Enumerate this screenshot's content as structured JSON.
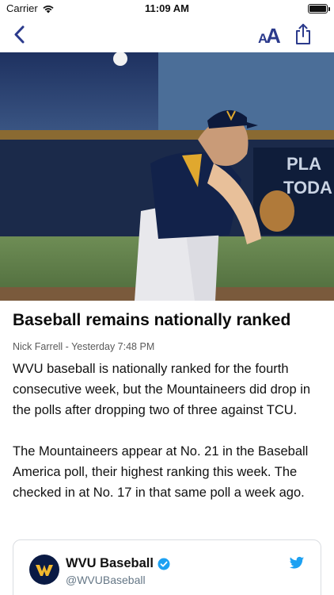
{
  "status_bar": {
    "carrier": "Carrier",
    "time": "11:09 AM",
    "icons": [
      "wifi-icon",
      "battery-icon"
    ]
  },
  "nav": {
    "back_icon": "chevron-left-icon",
    "text_size_small": "A",
    "text_size_large": "A",
    "share_icon": "share-icon",
    "accent_color": "#2b3a8c"
  },
  "article": {
    "hero_image": "baseball-pitcher-photo",
    "headline": "Baseball remains nationally ranked",
    "byline": "Nick Farrell - Yesterday 7:48 PM",
    "paragraphs": [
      "WVU baseball is nationally ranked for the fourth consecutive week, but the Mountaineers did drop in the polls after dropping two of three against TCU.",
      "The Mountaineers appear at No. 21 in the Baseball America poll, their highest ranking this week. The checked in at No. 17 in that same poll a week ago."
    ]
  },
  "tweet_embed": {
    "name": "WVU Baseball",
    "handle": "@WVUBaseball",
    "verified": true,
    "brand_color": "#1da1f2"
  }
}
